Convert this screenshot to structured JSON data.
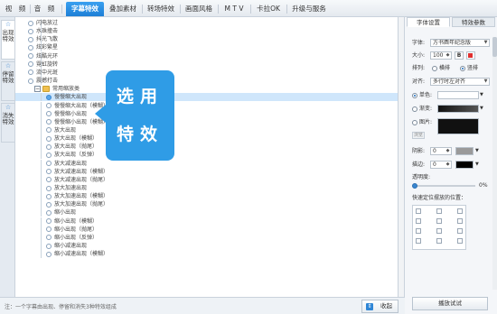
{
  "top_tabs": [
    "视　频",
    "音　频",
    "字幕特效",
    "叠加素材",
    "转场特效",
    "画面风格",
    "M T V",
    "卡拉OK",
    "升级与服务"
  ],
  "active_top_tab": 2,
  "vertical_tabs": [
    {
      "label": "出现特效",
      "icon": "star-icon"
    },
    {
      "label": "停留特效",
      "icon": "star-icon"
    },
    {
      "label": "消失特效",
      "icon": "star-icon"
    }
  ],
  "tree": {
    "items_top": [
      "闪电放过",
      "水珠撞击",
      "抖光飞散",
      "炫彩繁星",
      "炫酷光环",
      "霓虹旋转",
      "流中光斑",
      "震撼打击"
    ],
    "category": "常用缩放类",
    "items": [
      "慢慢缩大出现",
      "慢慢缩大出现（模糊）",
      "慢慢缩小出现",
      "慢慢缩小出现（模糊）",
      "放大出现",
      "放大出现（模糊）",
      "放大出现（抛尾）",
      "放大出现（反弹）",
      "放大减速出现",
      "放大减速出现（模糊）",
      "放大减速出现（抛尾）",
      "放大加速出现",
      "放大加速出现（模糊）",
      "放大加速出现（抛尾）",
      "缩小出现",
      "缩小出现（模糊）",
      "缩小出现（抛尾）",
      "缩小出现（反弹）",
      "缩小减速出现",
      "缩小减速出现（模糊）"
    ],
    "selected_index": 0
  },
  "callout": {
    "line1": "选用",
    "line2": "特效"
  },
  "status_note": "注：一个字幕由出现、停留和消失3种特效组成",
  "collapse_button": "收起",
  "right_panel": {
    "tabs": [
      "字体设置",
      "特效参数"
    ],
    "active_tab": 0,
    "font_label": "字体:",
    "font_value": "方书酉年纪念版",
    "size_label": "大小:",
    "size_value": "100",
    "bold_label": "B",
    "arrange_label": "排列:",
    "horizontal_label": "横排",
    "vertical_label": "竖排",
    "align_label": "对齐:",
    "align_value": "多行时左对齐",
    "solid_label": "单色:",
    "gradient_label": "渐变:",
    "image_label": "图片:",
    "browse_label": "浏览",
    "shadow_label": "阴影:",
    "shadow_value": "0",
    "stroke_label": "描边:",
    "stroke_value": "0",
    "opacity_label": "透明度:",
    "opacity_value": "0%",
    "position_label": "快速定位摆放的位置：",
    "apply_button": "播放试试",
    "colors": {
      "solid": "#ffffff",
      "shadow": "#9a9a9a",
      "stroke": "#000000"
    }
  }
}
